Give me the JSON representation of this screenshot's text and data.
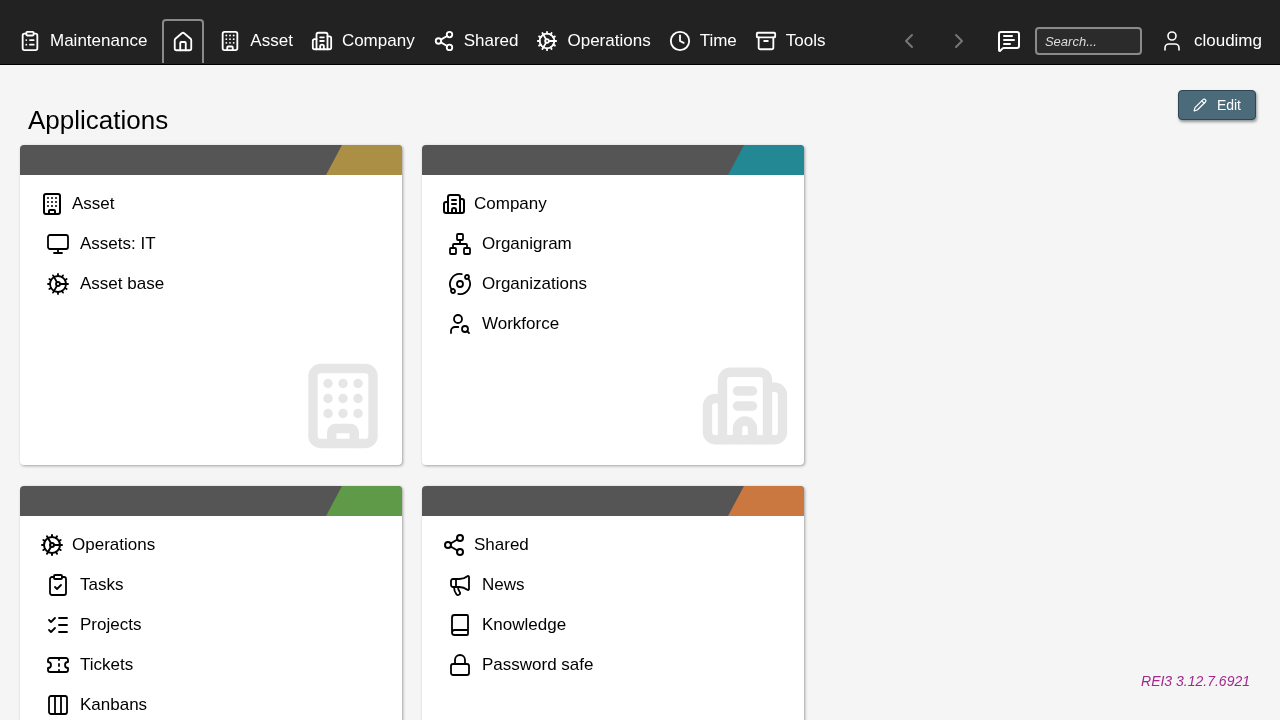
{
  "nav": {
    "items": [
      {
        "label": "Maintenance",
        "selected": false
      },
      {
        "kind": "home",
        "selected": true
      },
      {
        "label": "Asset",
        "selected": false
      },
      {
        "label": "Company",
        "selected": false
      },
      {
        "label": "Shared",
        "selected": false
      },
      {
        "label": "Operations",
        "selected": false
      },
      {
        "label": "Time",
        "selected": false
      },
      {
        "label": "Tools",
        "selected": false
      }
    ],
    "search": {
      "placeholder": "Search..."
    },
    "user": "cloudimg"
  },
  "page": {
    "title": "Applications",
    "edit_button": "Edit"
  },
  "cards": [
    {
      "title": "Asset",
      "color": "#ab8f44",
      "items": [
        "Assets: IT",
        "Asset base"
      ]
    },
    {
      "title": "Company",
      "color": "#238893",
      "items": [
        "Organigram",
        "Organizations",
        "Workforce"
      ]
    },
    {
      "title": "Operations",
      "color": "#5f9a48",
      "items": [
        "Tasks",
        "Projects",
        "Tickets",
        "Kanbans"
      ]
    },
    {
      "title": "Shared",
      "color": "#cb7840",
      "items": [
        "News",
        "Knowledge",
        "Password safe"
      ]
    }
  ],
  "version": "REI3 3.12.7.6921"
}
